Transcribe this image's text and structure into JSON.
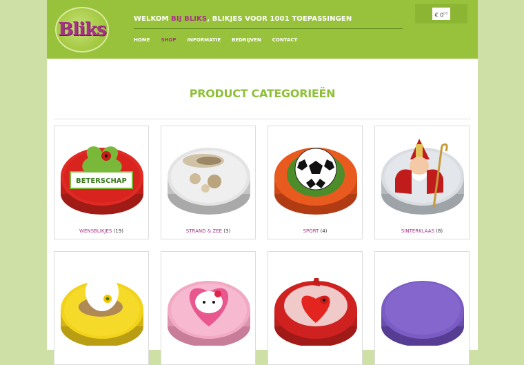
{
  "header": {
    "logo_text": "Bliks",
    "welcome_prefix": "WELKOM ",
    "welcome_brand": "BIJ BLIKS",
    "welcome_suffix": ", BLIKJES VOOR 1001 TOEPASSINGEN",
    "cart": {
      "currency": "€ 0",
      "cents": "00"
    }
  },
  "nav": [
    {
      "label": "HOME",
      "active": false
    },
    {
      "label": "SHOP",
      "active": true
    },
    {
      "label": "INFORMATIE",
      "active": false
    },
    {
      "label": "BEDRIJVEN",
      "active": false
    },
    {
      "label": "CONTACT",
      "active": false
    }
  ],
  "page_title": "PRODUCT CATEGORIEËN",
  "categories": [
    {
      "name": "WENSBLIKJES",
      "count": "(19)",
      "tin_color": "#d8231f",
      "decoration": "beterschap-label",
      "label_text": "BETERSCHAP"
    },
    {
      "name": "STRAND & ZEE",
      "count": "(3)",
      "tin_color": "#d9d9d9",
      "decoration": "seashells"
    },
    {
      "name": "SPORT",
      "count": "(4)",
      "tin_color": "#e5541c",
      "decoration": "soccer-ball"
    },
    {
      "name": "SINTERKLAAS",
      "count": "(8)",
      "tin_color": "#cfd4d9",
      "decoration": "sinterklaas-figure"
    },
    {
      "name": "",
      "count": "",
      "tin_color": "#f2d21a",
      "decoration": "easter-egg-nest"
    },
    {
      "name": "",
      "count": "",
      "tin_color": "#f2a9c3",
      "decoration": "hello-kitty-heart"
    },
    {
      "name": "",
      "count": "",
      "tin_color": "#cf2120",
      "decoration": "heart-ladybug"
    },
    {
      "name": "",
      "count": "",
      "tin_color": "#7b5cc4",
      "decoration": "plain-purple"
    }
  ]
}
